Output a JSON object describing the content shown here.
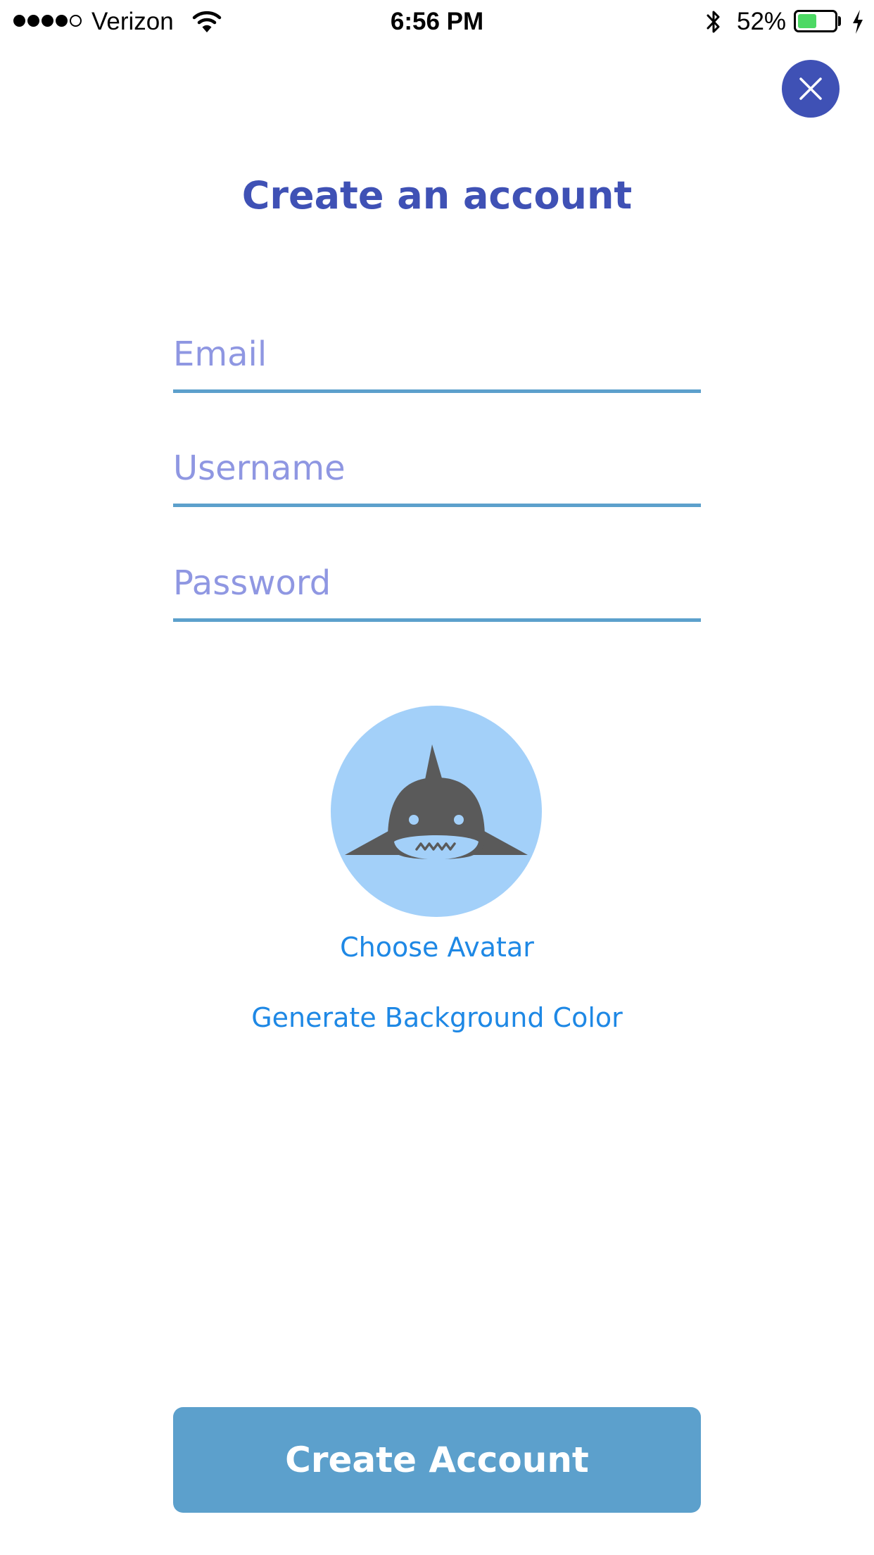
{
  "status_bar": {
    "carrier": "Verizon",
    "time": "6:56 PM",
    "battery_percent": "52%",
    "battery_level": 0.52,
    "signal_bars_filled": 4,
    "signal_bars_total": 5,
    "icons": [
      "signal-icon",
      "wifi-icon",
      "bluetooth-icon",
      "battery-icon",
      "charging-icon"
    ]
  },
  "header": {
    "close_icon": "close-icon",
    "title": "Create an account"
  },
  "form": {
    "email": {
      "placeholder": "Email",
      "value": ""
    },
    "username": {
      "placeholder": "Username",
      "value": ""
    },
    "password": {
      "placeholder": "Password",
      "value": ""
    }
  },
  "avatar": {
    "icon": "shark-icon",
    "background_color": "#a3d0f9",
    "choose_label": "Choose Avatar",
    "generate_label": "Generate Background Color"
  },
  "submit": {
    "label": "Create Account"
  },
  "colors": {
    "accent": "#3f51b5",
    "field_line": "#5ca0cc",
    "placeholder": "#8f97e2",
    "link": "#1e88e5",
    "button": "#5ca0cc",
    "battery_fill": "#4cd964"
  }
}
